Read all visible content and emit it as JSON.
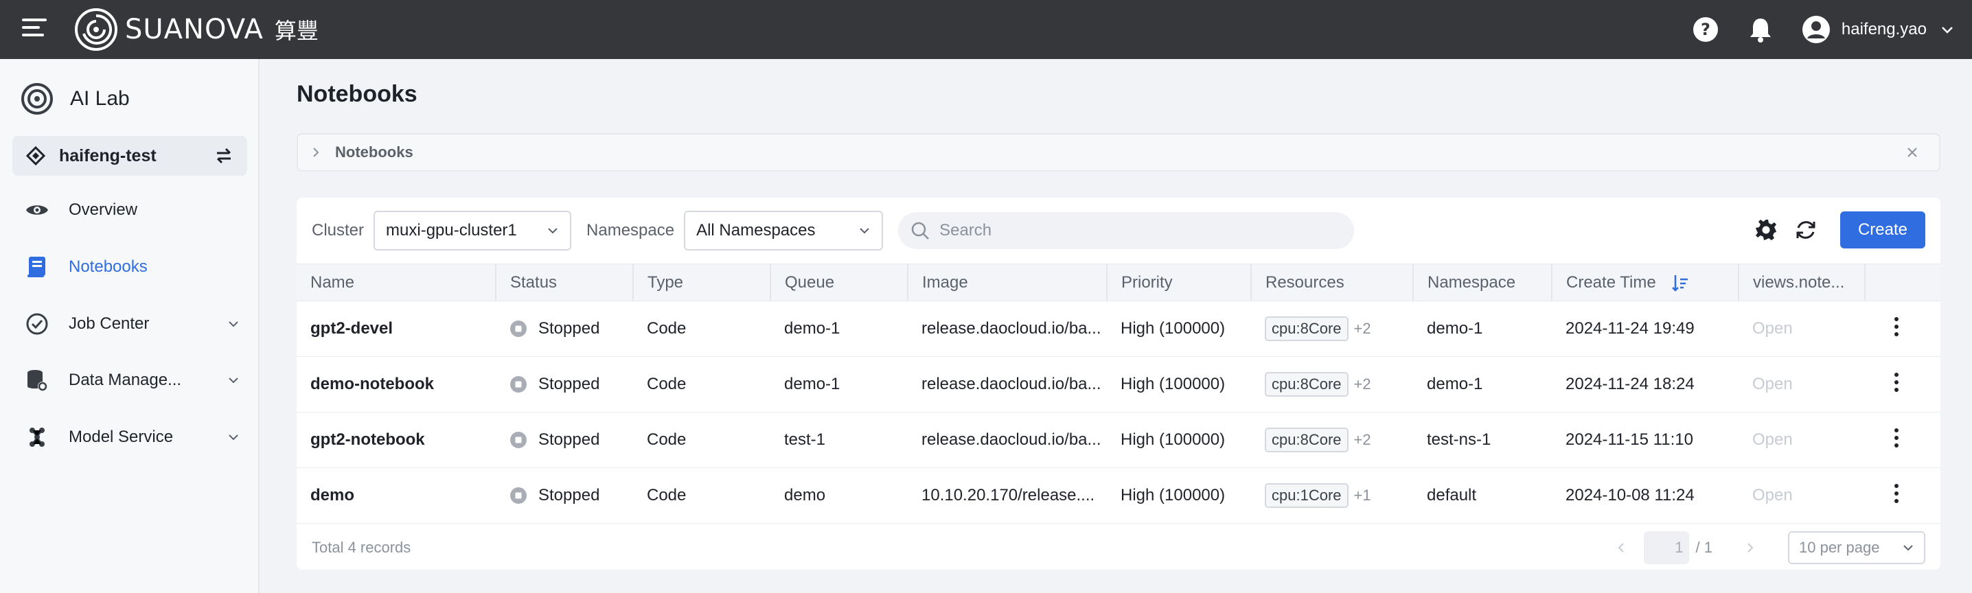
{
  "topbar": {
    "logo_text": "SUANOVA",
    "logo_cn": "算豐",
    "username": "haifeng.yao",
    "icons": [
      "menu-icon",
      "help-icon",
      "bell-icon",
      "user-avatar-icon",
      "chevron-down-icon"
    ]
  },
  "sidebar": {
    "app_title": "AI Lab",
    "workspace": "haifeng-test",
    "items": [
      {
        "label": "Overview",
        "icon": "eye-icon",
        "active": false
      },
      {
        "label": "Notebooks",
        "icon": "notebook-icon",
        "active": true
      },
      {
        "label": "Job Center",
        "icon": "job-icon",
        "expandable": true
      },
      {
        "label": "Data Manage...",
        "icon": "database-icon",
        "expandable": true
      },
      {
        "label": "Model Service",
        "icon": "model-icon",
        "expandable": true
      }
    ]
  },
  "main": {
    "page_title": "Notebooks",
    "breadcrumb": "Notebooks"
  },
  "toolbar": {
    "cluster_label": "Cluster",
    "cluster_value": "muxi-gpu-cluster1",
    "namespace_label": "Namespace",
    "namespace_value": "All Namespaces",
    "search_placeholder": "Search",
    "create_label": "Create"
  },
  "table": {
    "columns": [
      "Name",
      "Status",
      "Type",
      "Queue",
      "Image",
      "Priority",
      "Resources",
      "Namespace",
      "Create Time",
      "views.note..."
    ],
    "rows": [
      {
        "name": "gpt2-devel",
        "status": "Stopped",
        "type": "Code",
        "queue": "demo-1",
        "image": "release.daocloud.io/ba...",
        "priority": "High (100000)",
        "resource_tag": "cpu:8Core",
        "resource_more": "+2",
        "namespace": "demo-1",
        "create_time": "2024-11-24 19:49",
        "action": "Open"
      },
      {
        "name": "demo-notebook",
        "status": "Stopped",
        "type": "Code",
        "queue": "demo-1",
        "image": "release.daocloud.io/ba...",
        "priority": "High (100000)",
        "resource_tag": "cpu:8Core",
        "resource_more": "+2",
        "namespace": "demo-1",
        "create_time": "2024-11-24 18:24",
        "action": "Open"
      },
      {
        "name": "gpt2-notebook",
        "status": "Stopped",
        "type": "Code",
        "queue": "test-1",
        "image": "release.daocloud.io/ba...",
        "priority": "High (100000)",
        "resource_tag": "cpu:8Core",
        "resource_more": "+2",
        "namespace": "test-ns-1",
        "create_time": "2024-11-15 11:10",
        "action": "Open"
      },
      {
        "name": "demo",
        "status": "Stopped",
        "type": "Code",
        "queue": "demo",
        "image": "10.10.20.170/release....",
        "priority": "High (100000)",
        "resource_tag": "cpu:1Core",
        "resource_more": "+1",
        "namespace": "default",
        "create_time": "2024-10-08 11:24",
        "action": "Open"
      }
    ]
  },
  "footer": {
    "total": "Total 4 records",
    "current_page": "1",
    "page_total": "/ 1",
    "per_page": "10 per page"
  },
  "colors": {
    "topbar": "#35373b",
    "accent": "#2f6de1",
    "sidebar": "#f7f8fa",
    "background": "#f1f3f6"
  }
}
